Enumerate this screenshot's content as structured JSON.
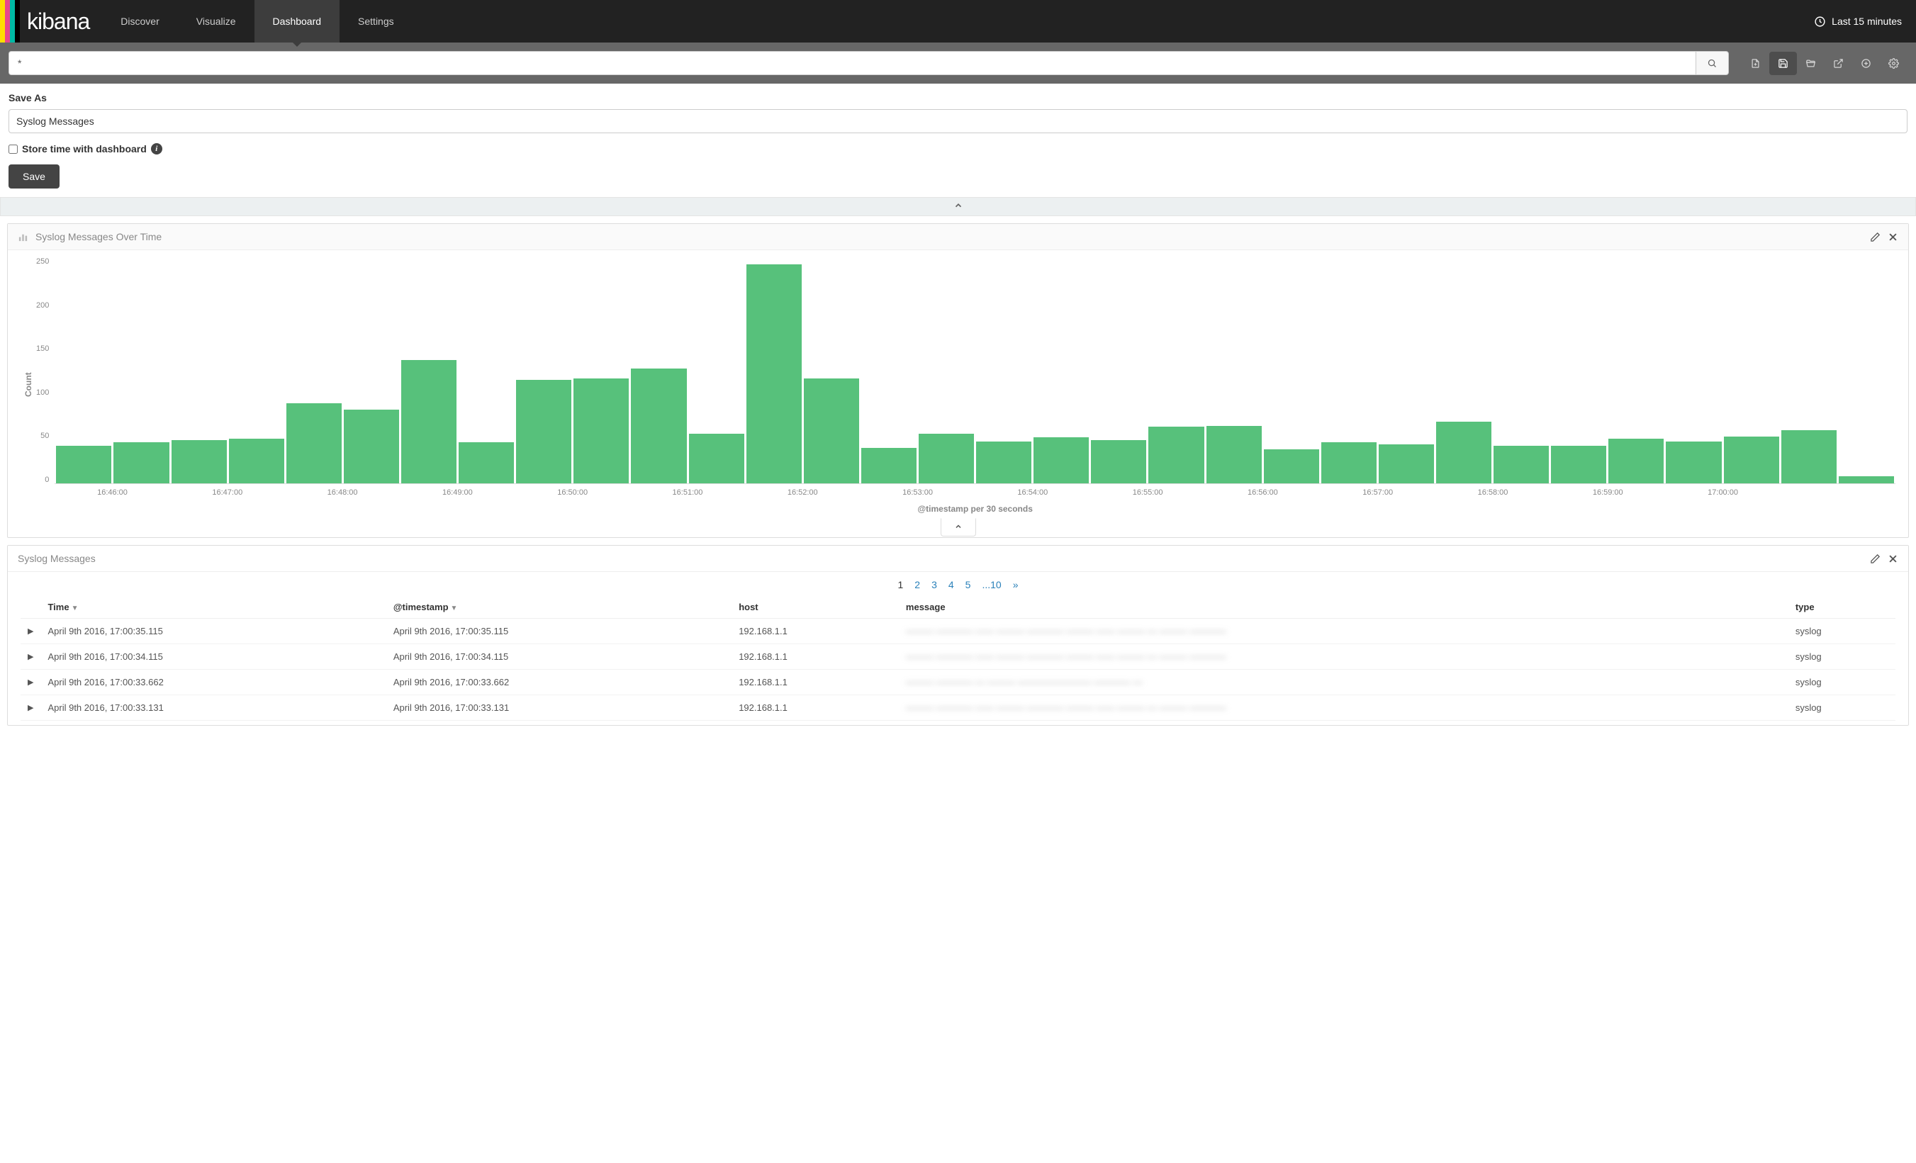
{
  "brand": {
    "name": "kibana",
    "stripe_colors": [
      "#ffde00",
      "#e8478b",
      "#00b9a4",
      "#000000"
    ]
  },
  "nav": {
    "items": [
      {
        "label": "Discover",
        "active": false
      },
      {
        "label": "Visualize",
        "active": false
      },
      {
        "label": "Dashboard",
        "active": true
      },
      {
        "label": "Settings",
        "active": false
      }
    ],
    "time_label": "Last 15 minutes"
  },
  "query": {
    "value": "*"
  },
  "save": {
    "heading": "Save As",
    "input_value": "Syslog Messages",
    "store_time_label": "Store time with dashboard",
    "store_time_checked": false,
    "button_label": "Save"
  },
  "panels": {
    "chart": {
      "title": "Syslog Messages Over Time",
      "ylabel": "Count",
      "xlabel": "@timestamp per 30 seconds"
    },
    "table": {
      "title": "Syslog Messages"
    }
  },
  "chart_data": {
    "type": "bar",
    "title": "Syslog Messages Over Time",
    "ylabel": "Count",
    "xlabel": "@timestamp per 30 seconds",
    "ylim": [
      0,
      260
    ],
    "y_ticks": [
      0,
      50,
      100,
      150,
      200,
      250
    ],
    "x_tick_labels": [
      "16:46:00",
      "16:47:00",
      "16:48:00",
      "16:49:00",
      "16:50:00",
      "16:51:00",
      "16:52:00",
      "16:53:00",
      "16:54:00",
      "16:55:00",
      "16:56:00",
      "16:57:00",
      "16:58:00",
      "16:59:00",
      "17:00:00"
    ],
    "values": [
      43,
      47,
      50,
      51,
      92,
      85,
      142,
      47,
      119,
      121,
      132,
      57,
      252,
      121,
      41,
      57,
      48,
      53,
      50,
      65,
      66,
      39,
      47,
      45,
      71,
      43,
      43,
      51,
      48,
      54,
      61,
      8
    ]
  },
  "pagination": {
    "pages": [
      "1",
      "2",
      "3",
      "4",
      "5",
      "...10"
    ],
    "current": "1",
    "next_symbol": "»"
  },
  "table": {
    "columns": [
      {
        "key": "Time",
        "sortable": true
      },
      {
        "key": "@timestamp",
        "sortable": true
      },
      {
        "key": "host",
        "sortable": false
      },
      {
        "key": "message",
        "sortable": false
      },
      {
        "key": "type",
        "sortable": false
      }
    ],
    "rows": [
      {
        "time": "April 9th 2016, 17:00:35.115",
        "timestamp": "April 9th 2016, 17:00:35.115",
        "host": "192.168.1.1",
        "message": "——— ———— —— ——— ———— ——— —— ——— — ——— ————",
        "type": "syslog"
      },
      {
        "time": "April 9th 2016, 17:00:34.115",
        "timestamp": "April 9th 2016, 17:00:34.115",
        "host": "192.168.1.1",
        "message": "——— ———— —— ——— ———— ——— —— ——— — ——— ————",
        "type": "syslog"
      },
      {
        "time": "April 9th 2016, 17:00:33.662",
        "timestamp": "April 9th 2016, 17:00:33.662",
        "host": "192.168.1.1",
        "message": "——— ———— — ——— ———————— ———— —",
        "type": "syslog"
      },
      {
        "time": "April 9th 2016, 17:00:33.131",
        "timestamp": "April 9th 2016, 17:00:33.131",
        "host": "192.168.1.1",
        "message": "——— ———— —— ——— ———— ——— —— ——— — ——— ————",
        "type": "syslog"
      }
    ]
  },
  "colors": {
    "bar": "#57c17b"
  }
}
